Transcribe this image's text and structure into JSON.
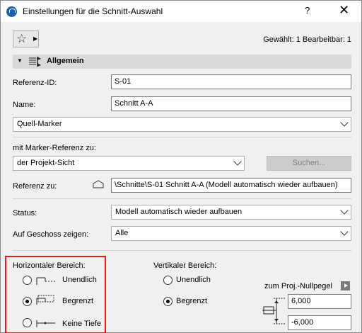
{
  "window": {
    "title": "Einstellungen für die Schnitt-Auswahl",
    "help": "?",
    "close": "✕"
  },
  "toolbar": {
    "selected_info": "Gewählt: 1 Bearbeitbar: 1"
  },
  "section": {
    "label": "Allgemein"
  },
  "fields": {
    "reference_id_label": "Referenz-ID:",
    "reference_id_value": "S-01",
    "name_label": "Name:",
    "name_value": "Schnitt A-A",
    "source_marker": "Quell-Marker",
    "marker_ref_label": "mit Marker-Referenz zu:",
    "marker_ref_value": "der Projekt-Sicht",
    "search_button": "Suchen...",
    "reference_to_label": "Referenz zu:",
    "reference_to_value": "\\Schnitte\\S-01 Schnitt A-A (Modell automatisch wieder aufbauen)",
    "status_label": "Status:",
    "status_value": "Modell automatisch wieder aufbauen",
    "story_label": "Auf Geschoss zeigen:",
    "story_value": "Alle"
  },
  "horizontal": {
    "title": "Horizontaler Bereich:",
    "options": [
      "Unendlich",
      "Begrenzt",
      "Keine Tiefe"
    ],
    "selected": "Begrenzt"
  },
  "vertical": {
    "title": "Vertikaler Bereich:",
    "options": [
      "Unendlich",
      "Begrenzt"
    ],
    "selected": "Begrenzt",
    "nullpegel_label": "zum Proj.-Nullpegel",
    "top_value": "6,000",
    "bottom_value": "-6,000"
  },
  "colors": {
    "highlight": "#e81b1b",
    "app_icon": "#1d5fa8"
  }
}
